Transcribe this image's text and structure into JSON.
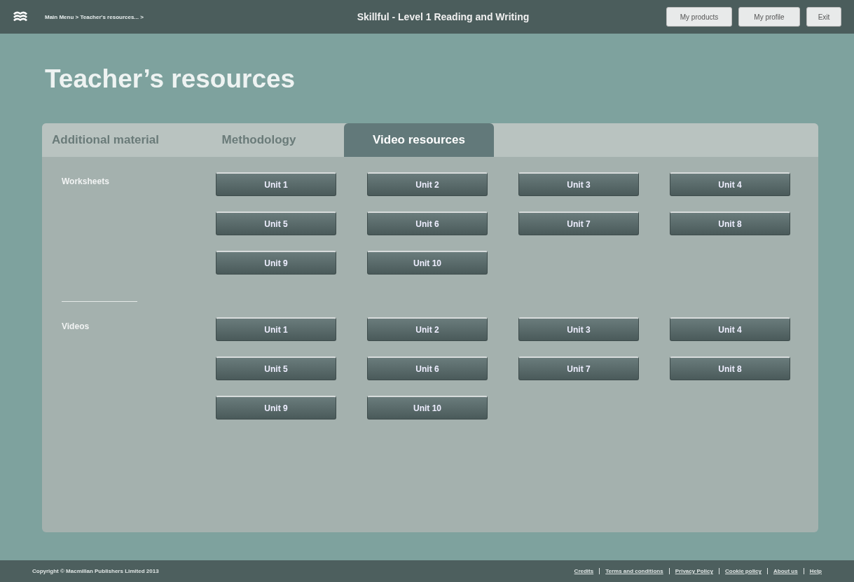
{
  "header": {
    "breadcrumb": "Main Menu >  Teacher's resources... >",
    "title": "Skillful - Level 1 Reading and Writing",
    "buttons": [
      "My products",
      "My profile",
      "Exit"
    ]
  },
  "page_title": "Teacher’s resources",
  "tabs": [
    {
      "label": "Additional material",
      "selected": false
    },
    {
      "label": "Methodology",
      "selected": false
    },
    {
      "label": "Video resources",
      "selected": true
    }
  ],
  "sections": [
    {
      "label": "Worksheets",
      "units": [
        "Unit 1",
        "Unit 2",
        "Unit 3",
        "Unit 4",
        "Unit 5",
        "Unit 6",
        "Unit 7",
        "Unit 8",
        "Unit 9",
        "Unit 10"
      ]
    },
    {
      "label": "Videos",
      "units": [
        "Unit 1",
        "Unit 2",
        "Unit 3",
        "Unit 4",
        "Unit 5",
        "Unit 6",
        "Unit 7",
        "Unit 8",
        "Unit 9",
        "Unit 10"
      ]
    }
  ],
  "footer": {
    "copyright": "Copyright © Macmillan Publishers Limited 2013",
    "links": [
      "Credits",
      "Terms and conditions",
      "Privacy Policy",
      "Cookie policy",
      "About us",
      "Help"
    ]
  }
}
